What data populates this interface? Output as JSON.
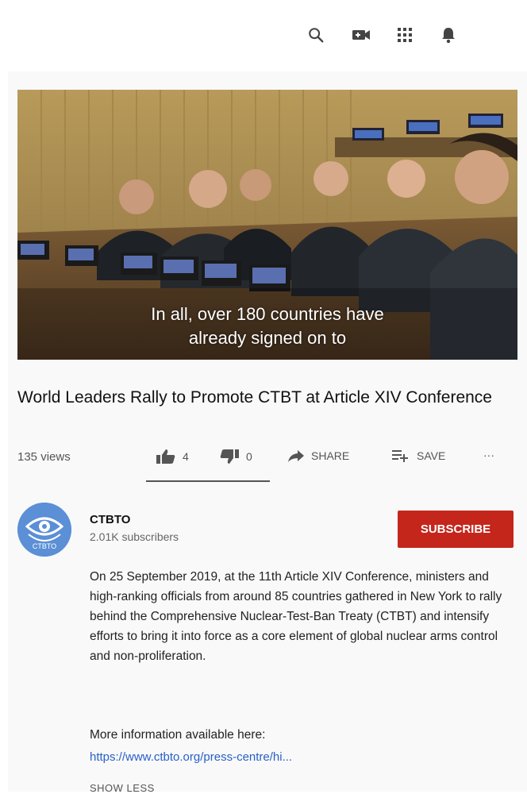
{
  "header": {
    "icons": [
      "search-icon",
      "video-camera-icon",
      "apps-grid-icon",
      "notifications-bell-icon"
    ]
  },
  "video": {
    "caption_line1": "In all, over 180 countries have",
    "caption_line2": "already signed on to"
  },
  "title": "World Leaders Rally to Promote CTBT at Article XIV Conference",
  "stats": {
    "views": "135 views",
    "likes": "4",
    "dislikes": "0",
    "share_label": "SHARE",
    "save_label": "SAVE",
    "more_label": "···"
  },
  "channel": {
    "name": "CTBTO",
    "subscribers": "2.01K subscribers",
    "subscribe_label": "SUBSCRIBE",
    "avatar_text": "CTBTO"
  },
  "description": {
    "text": "On 25 September 2019, at the 11th Article XIV Conference, ministers and high-ranking officials from around 85 countries gathered in New York to rally behind the Comprehensive Nuclear-Test-Ban Treaty (CTBT) and intensify efforts to bring it into force as a core element of global nuclear arms control and non-proliferation.",
    "more_info": "More information available here:",
    "link": "https://www.ctbto.org/press-centre/hi...",
    "show_less": "SHOW LESS"
  },
  "colors": {
    "subscribe": "#c4261c",
    "link": "#2860c8",
    "avatar": "#5b8fd6"
  }
}
